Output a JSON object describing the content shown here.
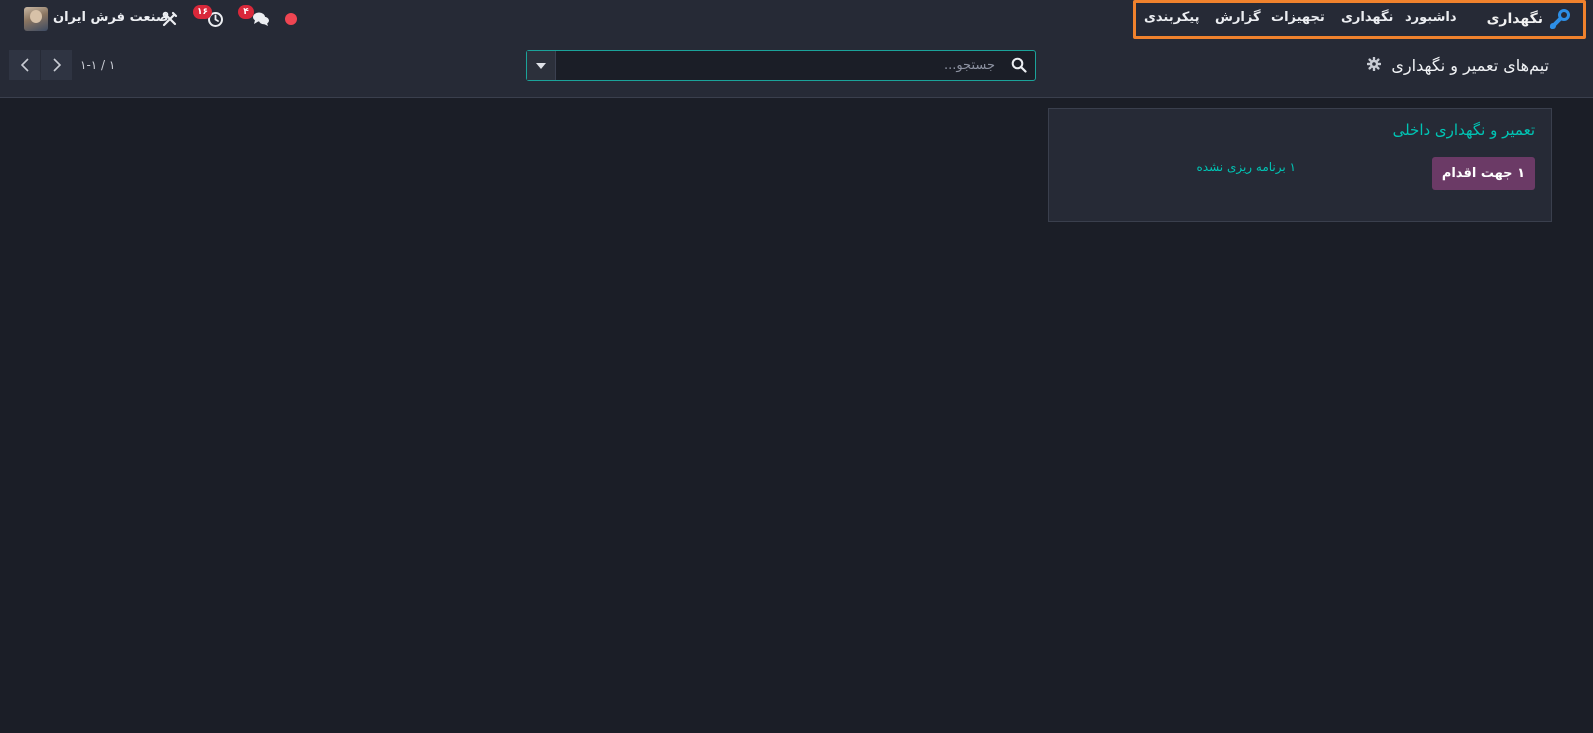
{
  "navbar": {
    "app_name": "نگهداری",
    "menu": [
      "داشبورد",
      "نگهداری",
      "تجهیزات",
      "گزارش",
      "پیکربندی"
    ],
    "company": "صنعت فرش ایران",
    "messages_badge": "۴",
    "activities_badge": "۱۶",
    "colors": {
      "accent": "#f0822d",
      "badge": "#d9283a",
      "status_dot": "#ef4552"
    }
  },
  "control_panel": {
    "breadcrumb": "تیم‌های تعمیر و نگهداری",
    "search_placeholder": "جستجو...",
    "pager_value": "۱-۱ / ۱"
  },
  "kanban": {
    "card": {
      "title": "تعمیر و نگهداری داخلی",
      "action_button": "۱ جهت اقدام",
      "unplanned_link": "۱ برنامه ریزی نشده"
    },
    "colors": {
      "title": "#00c4b4",
      "action": "#6b3a66"
    }
  }
}
